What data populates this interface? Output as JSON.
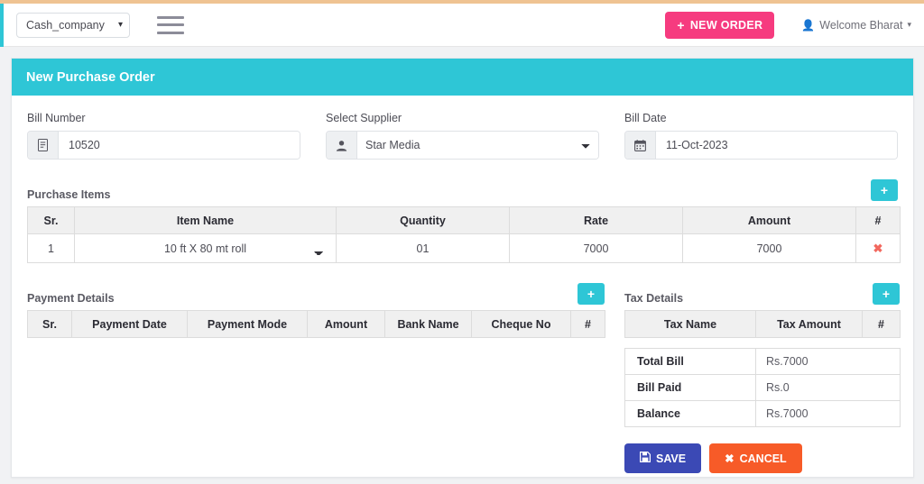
{
  "navbar": {
    "company_selected": "Cash_company",
    "company_options": [
      "Cash_company"
    ],
    "menu_icon": "hamburger-icon",
    "new_order_label": "NEW ORDER",
    "new_order_plus": "+",
    "welcome_label": "Welcome Bharat",
    "welcome_caret": "▾",
    "user_icon": "👤"
  },
  "card": {
    "title": "New Purchase Order"
  },
  "form": {
    "bill_number": {
      "label": "Bill Number",
      "value": "10520",
      "icon": "document-icon"
    },
    "supplier": {
      "label": "Select Supplier",
      "value": "Star Media",
      "options": [
        "Star Media"
      ],
      "icon": "user-icon"
    },
    "bill_date": {
      "label": "Bill Date",
      "value": "11-Oct-2023",
      "icon": "calendar-icon"
    }
  },
  "purchase_items": {
    "title": "Purchase Items",
    "add_label": "+",
    "columns": [
      "Sr.",
      "Item Name",
      "Quantity",
      "Rate",
      "Amount",
      "#"
    ],
    "rows": [
      {
        "sr": "1",
        "item_name": "10 ft X 80 mt roll",
        "item_options": [
          "10 ft X 80 mt roll"
        ],
        "quantity": "01",
        "rate": "7000",
        "amount": "7000",
        "delete": "✖"
      }
    ]
  },
  "payment_details": {
    "title": "Payment Details",
    "add_label": "+",
    "columns": [
      "Sr.",
      "Payment Date",
      "Payment Mode",
      "Amount",
      "Bank Name",
      "Cheque No",
      "#"
    ],
    "rows": []
  },
  "tax_details": {
    "title": "Tax Details",
    "add_label": "+",
    "columns": [
      "Tax Name",
      "Tax Amount",
      "#"
    ],
    "rows": [],
    "summary": [
      {
        "key": "Total Bill",
        "value": "Rs.7000"
      },
      {
        "key": "Bill Paid",
        "value": "Rs.0"
      },
      {
        "key": "Balance",
        "value": "Rs.7000"
      }
    ]
  },
  "actions": {
    "save_label": "SAVE",
    "save_icon": "💾",
    "cancel_label": "CANCEL",
    "cancel_icon": "✖"
  },
  "colors": {
    "teal": "#2ec6d6",
    "pink": "#f63b7f",
    "save_blue": "#3b49b5",
    "cancel_orange": "#f75b28",
    "delete_red": "#f2685e",
    "top_strip": "#efc392"
  }
}
